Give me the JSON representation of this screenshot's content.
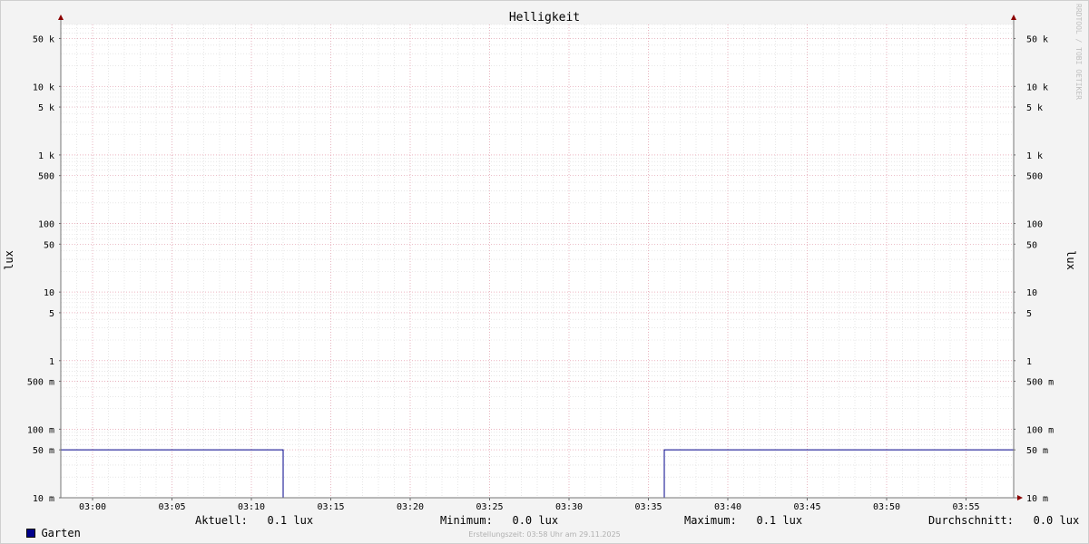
{
  "chart_data": {
    "type": "line",
    "title": "Helligkeit",
    "ylabel": "lux",
    "yscale": "log",
    "ylim": [
      0.01,
      80000
    ],
    "xlim": [
      "02:58",
      "03:58"
    ],
    "x_ticks": [
      "03:00",
      "03:05",
      "03:10",
      "03:15",
      "03:20",
      "03:25",
      "03:30",
      "03:35",
      "03:40",
      "03:45",
      "03:50",
      "03:55"
    ],
    "y_ticks": [
      {
        "value": 50000,
        "label": "50 k"
      },
      {
        "value": 10000,
        "label": "10 k"
      },
      {
        "value": 5000,
        "label": "5 k"
      },
      {
        "value": 1000,
        "label": "1 k"
      },
      {
        "value": 500,
        "label": "500"
      },
      {
        "value": 100,
        "label": "100"
      },
      {
        "value": 50,
        "label": "50"
      },
      {
        "value": 10,
        "label": "10"
      },
      {
        "value": 5,
        "label": "5"
      },
      {
        "value": 1,
        "label": "1"
      },
      {
        "value": 0.5,
        "label": "500 m"
      },
      {
        "value": 0.1,
        "label": "100 m"
      },
      {
        "value": 0.05,
        "label": "50 m"
      },
      {
        "value": 0.01,
        "label": "10 m"
      }
    ],
    "grid": true,
    "series": [
      {
        "name": "Garten",
        "color": "#00008b",
        "step": true,
        "points": [
          [
            "02:58",
            0.05
          ],
          [
            "03:12",
            0.05
          ],
          [
            "03:12",
            0.01
          ],
          [
            "03:36",
            0.01
          ],
          [
            "03:36",
            0.05
          ],
          [
            "03:58",
            0.05
          ]
        ]
      }
    ]
  },
  "legend": {
    "series_name": "Garten",
    "swatch_color": "#00008b",
    "current": "Aktuell:   0.1 lux",
    "minimum": "Minimum:   0.0 lux",
    "maximum": "Maximum:   0.1 lux",
    "average": "Durchschnitt:   0.0 lux"
  },
  "footer": "Erstellungszeit: 03:58 Uhr am 29.11.2025",
  "watermark": "RRDTOOL / TOBI OETIKER"
}
